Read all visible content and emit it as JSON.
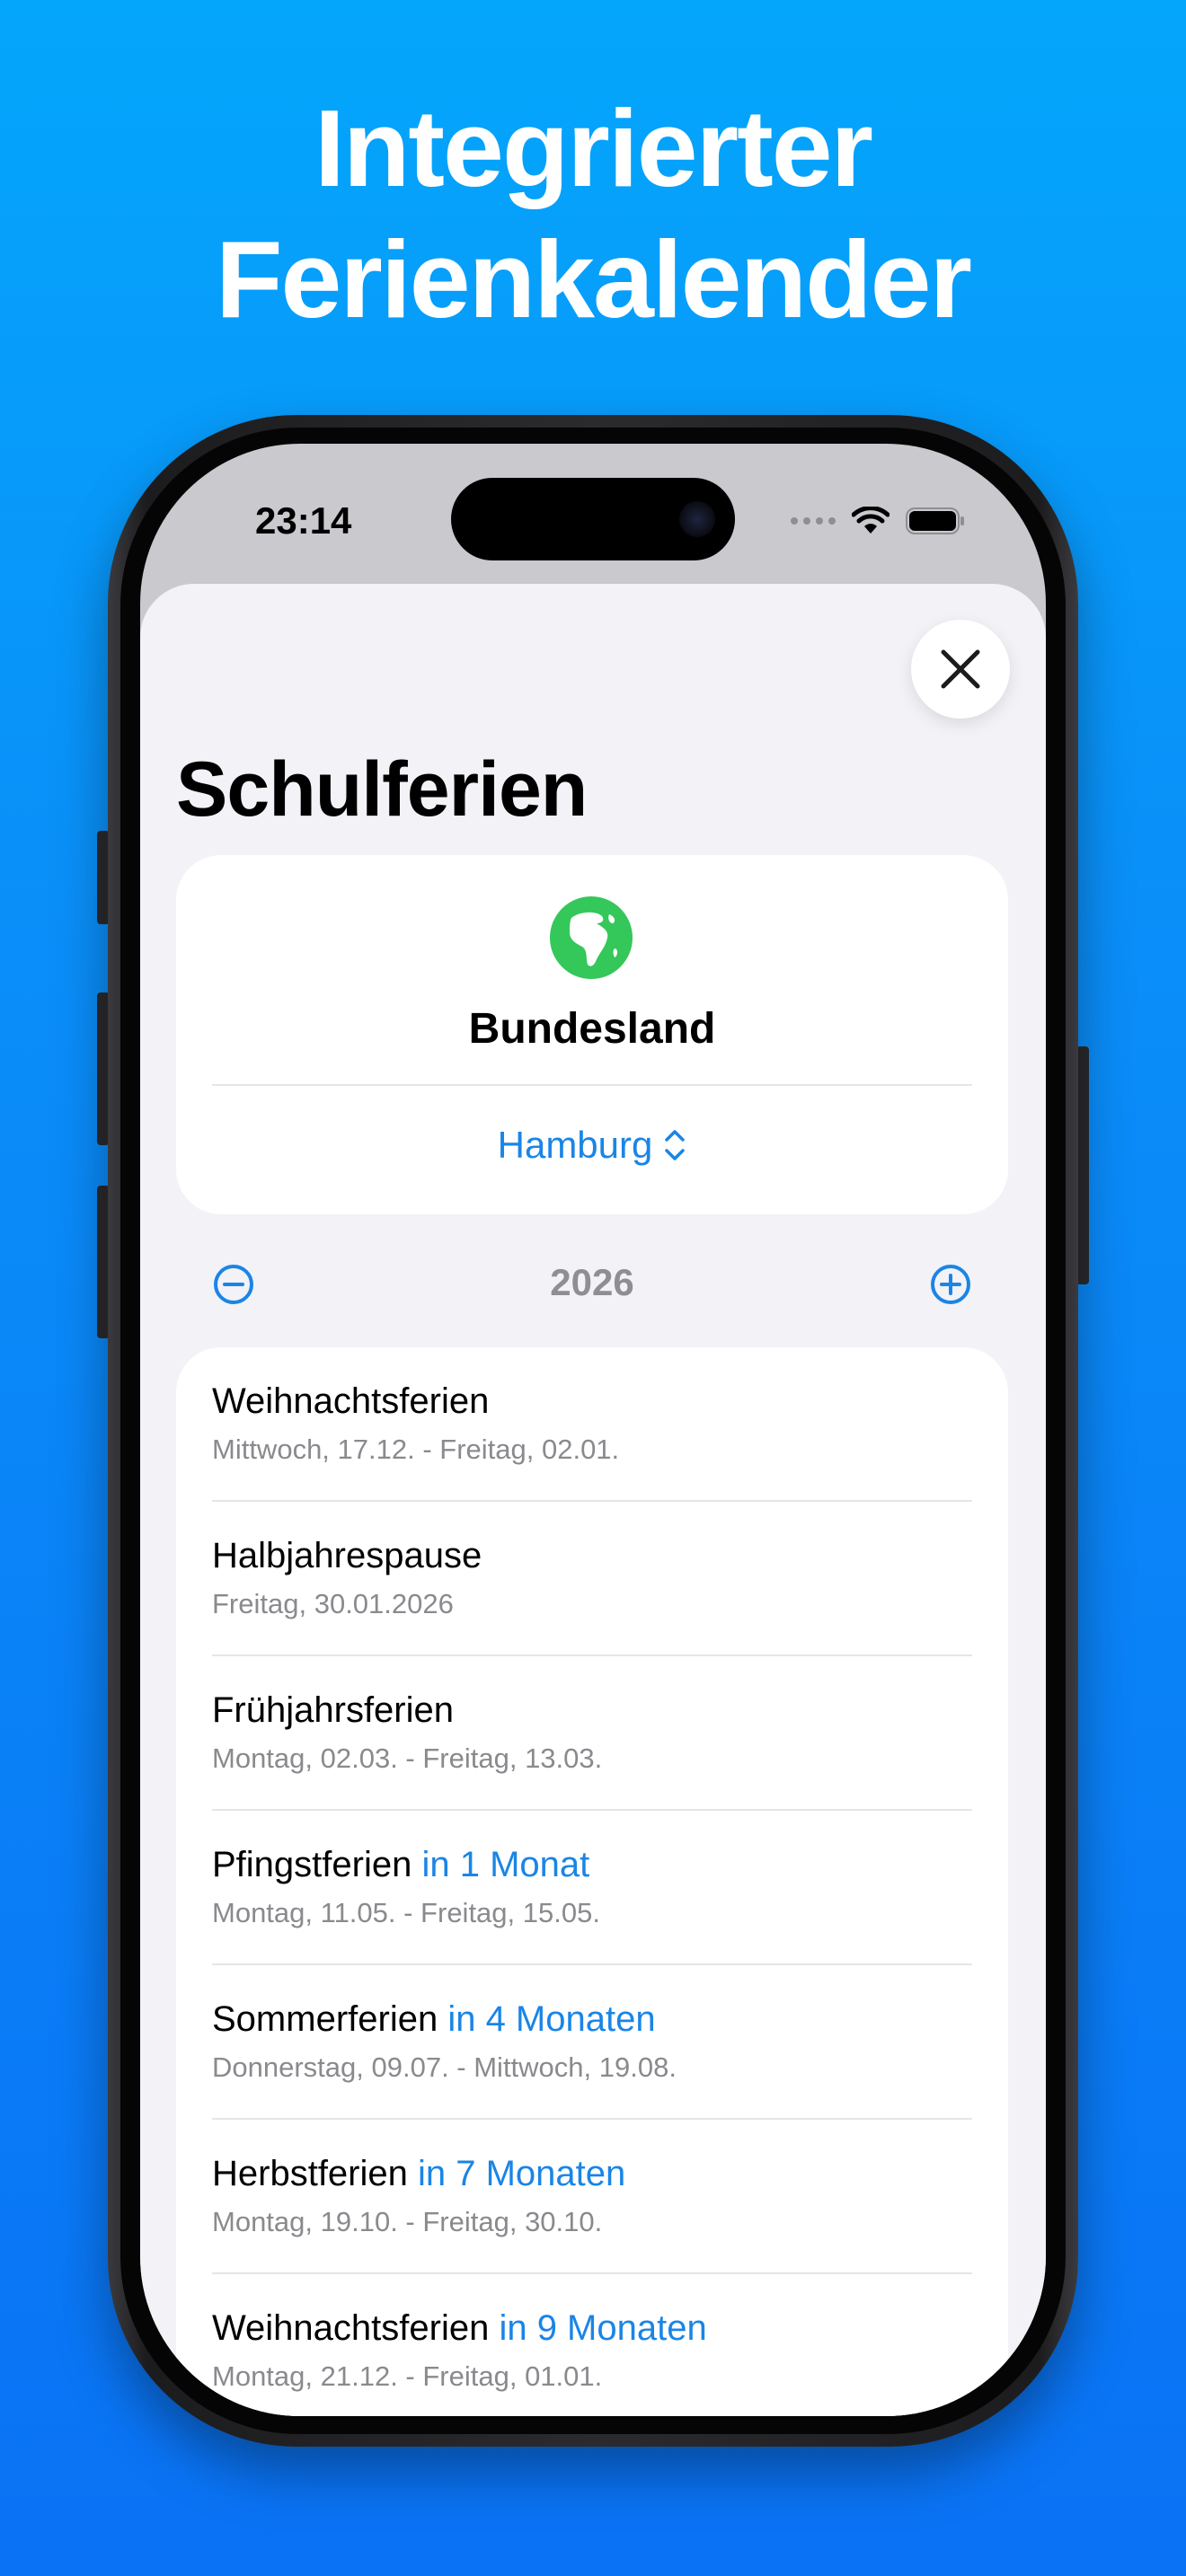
{
  "headline": {
    "line1": "Integrierter",
    "line2": "Ferienkalender"
  },
  "status_bar": {
    "time": "23:14",
    "icons": [
      "cellular-dots-icon",
      "wifi-icon",
      "battery-icon"
    ]
  },
  "sheet": {
    "title": "Schulferien",
    "close_icon": "close-icon",
    "state": {
      "icon": "globe-icon",
      "label": "Bundesland",
      "selected": "Hamburg"
    },
    "year": {
      "value": "2026",
      "minus_icon": "minus-circle-icon",
      "plus_icon": "plus-circle-icon"
    },
    "holidays": [
      {
        "name": "Weihnachtsferien",
        "relative": "",
        "dates": "Mittwoch, 17.12. - Freitag, 02.01."
      },
      {
        "name": "Halbjahrespause",
        "relative": "",
        "dates": "Freitag, 30.01.2026"
      },
      {
        "name": "Frühjahrsferien",
        "relative": "",
        "dates": "Montag, 02.03. - Freitag, 13.03."
      },
      {
        "name": "Pfingstferien",
        "relative": "in 1 Monat",
        "dates": "Montag, 11.05. - Freitag, 15.05."
      },
      {
        "name": "Sommerferien",
        "relative": "in 4 Monaten",
        "dates": "Donnerstag, 09.07. - Mittwoch, 19.08."
      },
      {
        "name": "Herbstferien",
        "relative": "in 7 Monaten",
        "dates": "Montag, 19.10. - Freitag, 30.10."
      },
      {
        "name": "Weihnachtsferien",
        "relative": "in 9 Monaten",
        "dates": "Montag, 21.12. - Freitag, 01.01."
      }
    ]
  },
  "colors": {
    "accent": "#1a85e6",
    "background_top": "#04a6fb",
    "background_bottom": "#0a72f5",
    "globe": "#34c759"
  }
}
